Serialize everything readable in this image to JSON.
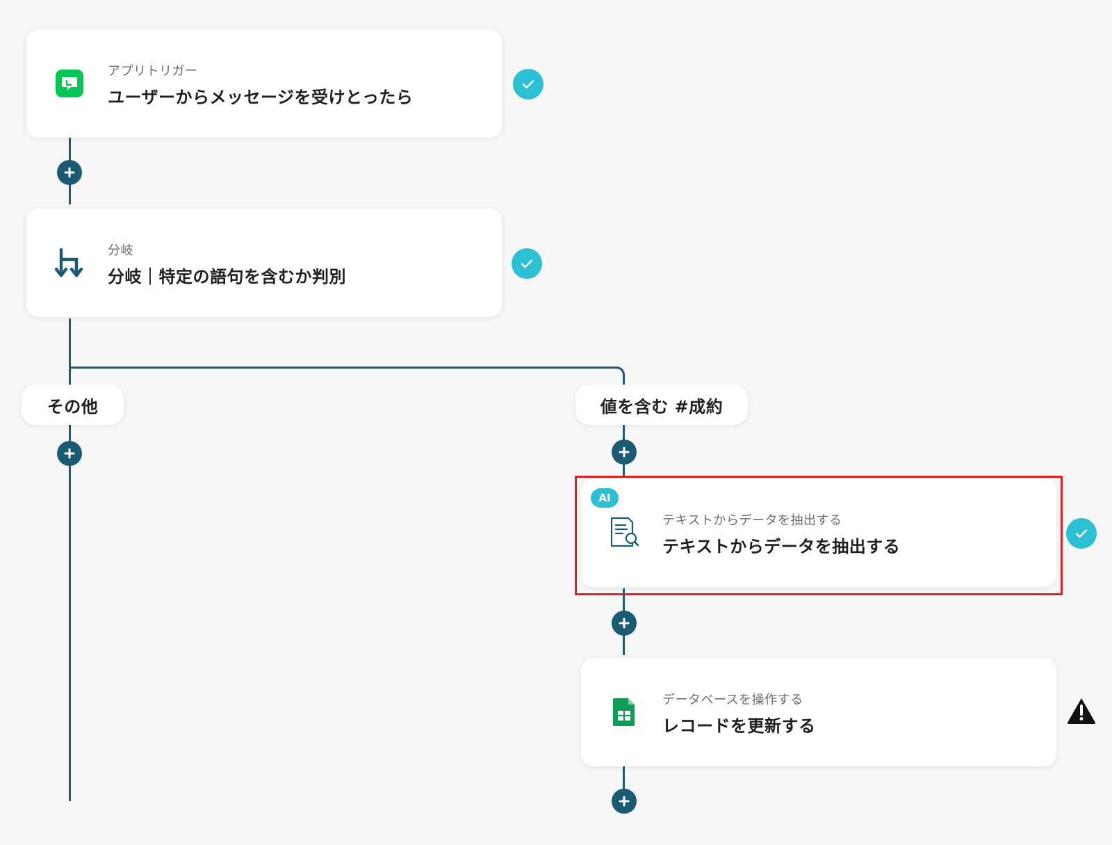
{
  "steps": {
    "trigger": {
      "category": "アプリトリガー",
      "title": "ユーザーからメッセージを受けとったら",
      "icon": "line-app-icon"
    },
    "branch": {
      "category": "分岐",
      "title": "分岐｜特定の語句を含むか判別",
      "icon": "branch-icon"
    },
    "extract": {
      "badge": "AI",
      "category": "テキストからデータを抽出する",
      "title": "テキストからデータを抽出する",
      "icon": "document-search-icon"
    },
    "database": {
      "category": "データベースを操作する",
      "title": "レコードを更新する",
      "icon": "google-sheets-icon"
    }
  },
  "branches": {
    "other_label": "その他",
    "match_label": "値を含む #成約"
  },
  "colors": {
    "line": "#1b5a73",
    "check": "#2bc0d4",
    "highlight": "#e02020",
    "line_app_green": "#06c755",
    "sheets_green": "#0f9d58"
  }
}
